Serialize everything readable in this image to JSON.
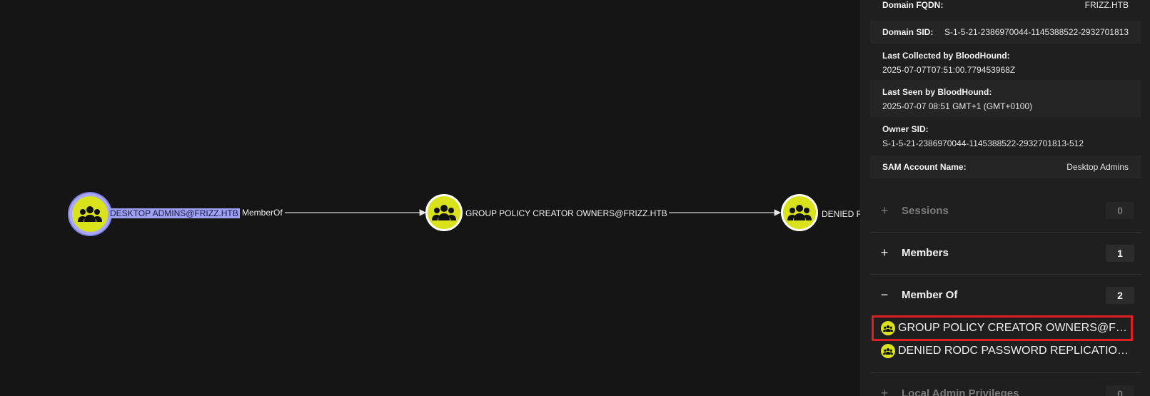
{
  "graph": {
    "nodes": [
      {
        "label": "DESKTOP ADMINS@FRIZZ.HTB",
        "icon": "group-icon",
        "selected": true
      },
      {
        "label": "GROUP POLICY CREATOR OWNERS@FRIZZ.HTB",
        "icon": "group-icon",
        "selected": false
      },
      {
        "label": "DENIED RO",
        "icon": "group-icon",
        "selected": false
      }
    ],
    "edges": [
      {
        "label": "MemberOf"
      }
    ]
  },
  "panel": {
    "properties": [
      {
        "key": "Domain FQDN:",
        "value": "FRIZZ.HTB"
      },
      {
        "key": "Domain SID:",
        "value": "S-1-5-21-2386970044-1145388522-2932701813"
      },
      {
        "key": "Last Collected by BloodHound:",
        "value": "2025-07-07T07:51:00.779453968Z"
      },
      {
        "key": "Last Seen by BloodHound:",
        "value": "2025-07-07 08:51 GMT+1 (GMT+0100)"
      },
      {
        "key": "Owner SID:",
        "value": "S-1-5-21-2386970044-1145388522-2932701813-512"
      },
      {
        "key": "SAM Account Name:",
        "value": "Desktop Admins"
      }
    ],
    "sections": [
      {
        "title": "Sessions",
        "toggle": "+",
        "count": "0"
      },
      {
        "title": "Members",
        "toggle": "+",
        "count": "1"
      },
      {
        "title": "Member Of",
        "toggle": "−",
        "count": "2"
      },
      {
        "title": "Local Admin Privileges",
        "toggle": "+",
        "count": "0"
      }
    ],
    "member_of_items": [
      {
        "label": "GROUP POLICY CREATOR OWNERS@FRIZZ...",
        "icon": "group-icon"
      },
      {
        "label": "DENIED RODC PASSWORD REPLICATION G...",
        "icon": "group-icon"
      }
    ]
  },
  "colors": {
    "node_fill": "#d9e21a",
    "selection": "#9da0f5",
    "highlight_box": "#e01f1f",
    "background": "#151515",
    "panel": "#1f1f1f"
  }
}
